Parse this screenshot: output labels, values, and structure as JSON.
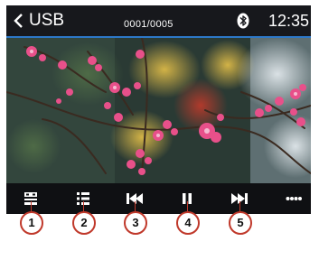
{
  "status_bar": {
    "back_icon": "chevron-left-icon",
    "source": "USB",
    "track_counter": "0001/0005",
    "bluetooth_icon": "bluetooth-icon",
    "clock": "12:35"
  },
  "colors": {
    "accent_line": "#2d78c8",
    "callout": "#c0392b",
    "blossom": "#e8508a"
  },
  "artwork": {
    "subject": "pink-blossom-branches-photo"
  },
  "controls": [
    {
      "icon": "source-menu-icon",
      "callout": "1"
    },
    {
      "icon": "playlist-icon",
      "callout": "2"
    },
    {
      "icon": "previous-track-icon",
      "callout": "3"
    },
    {
      "icon": "pause-icon",
      "callout": "4"
    },
    {
      "icon": "next-track-icon",
      "callout": "5"
    },
    {
      "icon": "more-options-icon",
      "callout": ""
    }
  ]
}
